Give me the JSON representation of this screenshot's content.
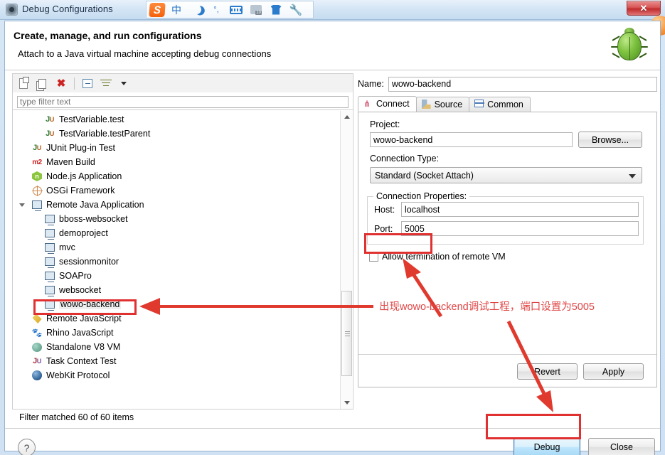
{
  "window": {
    "title": "Debug Configurations",
    "title_icon": "debug-config-icon",
    "close_label": "✕"
  },
  "ime_toolbar": {
    "items": [
      {
        "name": "sogou-logo-icon",
        "label": "S"
      },
      {
        "name": "chinese-mode-icon",
        "label": "中"
      },
      {
        "name": "moon-icon",
        "label": ""
      },
      {
        "name": "punctuation-icon",
        "label": "°,"
      },
      {
        "name": "soft-keyboard-icon",
        "label": ""
      },
      {
        "name": "toolbox-icon",
        "label": ""
      },
      {
        "name": "skin-shirt-icon",
        "label": ""
      },
      {
        "name": "settings-wrench-icon",
        "label": "🔧"
      }
    ]
  },
  "header": {
    "title": "Create, manage, and run configurations",
    "subtitle": "Attach to a Java virtual machine accepting debug connections",
    "icon": "green-bug-icon"
  },
  "left_panel": {
    "toolbar": [
      {
        "name": "new-configuration-icon",
        "tooltip": "New launch configuration"
      },
      {
        "name": "duplicate-configuration-icon",
        "tooltip": "Duplicate"
      },
      {
        "name": "delete-configuration-icon",
        "tooltip": "Delete"
      },
      {
        "name": "collapse-all-icon",
        "tooltip": "Collapse All"
      },
      {
        "name": "filter-icon",
        "tooltip": "Filter"
      },
      {
        "name": "view-menu-chevron-icon",
        "tooltip": "View Menu"
      }
    ],
    "filter": {
      "value": "",
      "placeholder": "type filter text"
    },
    "tree": [
      {
        "label": "TestVariable.test",
        "icon": "junit-test-icon",
        "indent": 2
      },
      {
        "label": "TestVariable.testParent",
        "icon": "junit-test-icon",
        "indent": 2
      },
      {
        "label": "JUnit Plug-in Test",
        "icon": "junit-plugin-icon",
        "indent": 1
      },
      {
        "label": "Maven Build",
        "icon": "maven-icon",
        "indent": 1
      },
      {
        "label": "Node.js Application",
        "icon": "nodejs-icon",
        "indent": 1
      },
      {
        "label": "OSGi Framework",
        "icon": "osgi-icon",
        "indent": 1
      },
      {
        "label": "Remote Java Application",
        "icon": "remote-java-icon",
        "indent": 1,
        "expanded": true
      },
      {
        "label": "bboss-websocket",
        "icon": "remote-java-icon",
        "indent": 2
      },
      {
        "label": "demoproject",
        "icon": "remote-java-icon",
        "indent": 2
      },
      {
        "label": "mvc",
        "icon": "remote-java-icon",
        "indent": 2
      },
      {
        "label": "sessionmonitor",
        "icon": "remote-java-icon",
        "indent": 2
      },
      {
        "label": "SOAPro",
        "icon": "remote-java-icon",
        "indent": 2
      },
      {
        "label": "websocket",
        "icon": "remote-java-icon",
        "indent": 2
      },
      {
        "label": "wowo-backend",
        "icon": "remote-java-icon",
        "indent": 2,
        "selected": true
      },
      {
        "label": "Remote JavaScript",
        "icon": "javascript-icon",
        "indent": 1
      },
      {
        "label": "Rhino JavaScript",
        "icon": "rhino-icon",
        "indent": 1
      },
      {
        "label": "Standalone V8 VM",
        "icon": "v8-icon",
        "indent": 1
      },
      {
        "label": "Task Context Test",
        "icon": "junit-task-icon",
        "indent": 1
      },
      {
        "label": "WebKit Protocol",
        "icon": "webkit-icon",
        "indent": 1
      }
    ],
    "status": "Filter matched 60 of 60 items"
  },
  "right_panel": {
    "name_label": "Name:",
    "name_value": "wowo-backend",
    "tabs": [
      {
        "label": "Connect",
        "icon": "connect-icon",
        "active": true
      },
      {
        "label": "Source",
        "icon": "source-icon",
        "active": false
      },
      {
        "label": "Common",
        "icon": "common-icon",
        "active": false
      }
    ],
    "project_label": "Project:",
    "project_value": "wowo-backend",
    "browse_label": "Browse...",
    "connection_type_label": "Connection Type:",
    "connection_type_value": "Standard (Socket Attach)",
    "connection_properties_label": "Connection Properties:",
    "host_label": "Host:",
    "host_value": "localhost",
    "port_label": "Port:",
    "port_value": "5005",
    "allow_termination_label": "Allow termination of remote VM",
    "allow_termination_checked": false,
    "revert_label": "Revert",
    "apply_label": "Apply"
  },
  "footer": {
    "help_label": "?",
    "debug_label": "Debug",
    "close_label": "Close"
  },
  "annotations": {
    "note_text": "出现wowo-backend调试工程，端口设置为5005",
    "color": "#e04444",
    "highlights": [
      "wowo-backend-tree-item",
      "port-field",
      "debug-button"
    ]
  }
}
